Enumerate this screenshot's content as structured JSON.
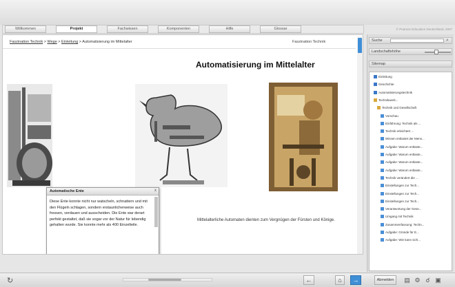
{
  "tabs": [
    {
      "label": "Willkommen"
    },
    {
      "label": "Projekt"
    },
    {
      "label": "Fachwissen"
    },
    {
      "label": "Komponenten"
    },
    {
      "label": "Hilfe"
    },
    {
      "label": "Glossar"
    }
  ],
  "active_tab": "Projekt",
  "copyright": "© Pearson Education Deutschland, 2007",
  "breadcrumb": {
    "link1": "Faszination Technik",
    "link2": "Wege",
    "link3": "Einleitung",
    "sep": ">",
    "current": "Automatisierung im Mittelalter"
  },
  "section_label": "Faszination Technik",
  "page_title": "Automatisierung im Mittelalter",
  "caption": "Mittelalterliche Automaten dienten zum Vergnügen der Fürsten und Könige.",
  "popup": {
    "title": "Automatische Ente",
    "close": "x",
    "text": "Diese Ente konnte nicht nur watscheln, schnattern und mit den Flügeln schlagen, sondern erstaunlicherweise auch fressen, verdauen und ausscheiden. Die Ente war derart perfekt gestaltet, daß sie sogar vor der Natur für lebendig gehalten wurde. Sie konnte mehr als 400 Einzelteile."
  },
  "sidebar": {
    "search_label": "Suche",
    "size_label": "Landschaftshöhe",
    "nav_label": "Sitemap",
    "tree": [
      {
        "label": "Einleitung",
        "icon": "doc-icon",
        "level": 0
      },
      {
        "label": "Geschichte",
        "icon": "doc-icon",
        "level": 0
      },
      {
        "label": "Automatisierungstechnik",
        "icon": "doc-icon",
        "level": 0
      },
      {
        "label": "Technikwerk...",
        "icon": "folder-icon",
        "level": 0
      },
      {
        "label": "Technik und Gesellschaft",
        "icon": "folder-icon",
        "level": 1
      },
      {
        "label": "Vorschau",
        "icon": "page-icon",
        "level": 2
      },
      {
        "label": "Einführung: Technik als ...",
        "icon": "page-icon",
        "level": 2
      },
      {
        "label": "Technik erleichtert ...",
        "icon": "page-icon",
        "level": 2
      },
      {
        "label": "Wissen entlastet der Mens...",
        "icon": "page-icon",
        "level": 2
      },
      {
        "label": "Aufgabe: Warum entlaste...",
        "icon": "page-icon",
        "level": 2
      },
      {
        "label": "Aufgabe: Warum entlaste...",
        "icon": "page-icon",
        "level": 2
      },
      {
        "label": "Aufgabe: Warum entlaste...",
        "icon": "page-icon",
        "level": 2
      },
      {
        "label": "Aufgabe: Warum entlaste...",
        "icon": "page-icon",
        "level": 2
      },
      {
        "label": "Technik verändert die ...",
        "icon": "page-icon",
        "level": 2
      },
      {
        "label": "Einstellungen zur Tech...",
        "icon": "page-icon",
        "level": 2
      },
      {
        "label": "Einstellungen zur Tech...",
        "icon": "page-icon",
        "level": 2
      },
      {
        "label": "Einstellungen zur Tech...",
        "icon": "page-icon",
        "level": 2
      },
      {
        "label": "Verantwortung der Gese...",
        "icon": "page-icon",
        "level": 2
      },
      {
        "label": "Umgang mit Technik",
        "icon": "page-icon",
        "level": 2
      },
      {
        "label": "Zusammenfassung: Techn...",
        "icon": "page-icon",
        "level": 2
      },
      {
        "label": "Aufgabe: Gründe für E...",
        "icon": "page-icon",
        "level": 2
      },
      {
        "label": "Aufgabe: Wie kann sich...",
        "icon": "page-icon",
        "level": 2
      }
    ]
  },
  "bottom": {
    "back_label": "←",
    "home_label": "⌂",
    "next_label": "→",
    "logout_label": "Abmelden"
  }
}
